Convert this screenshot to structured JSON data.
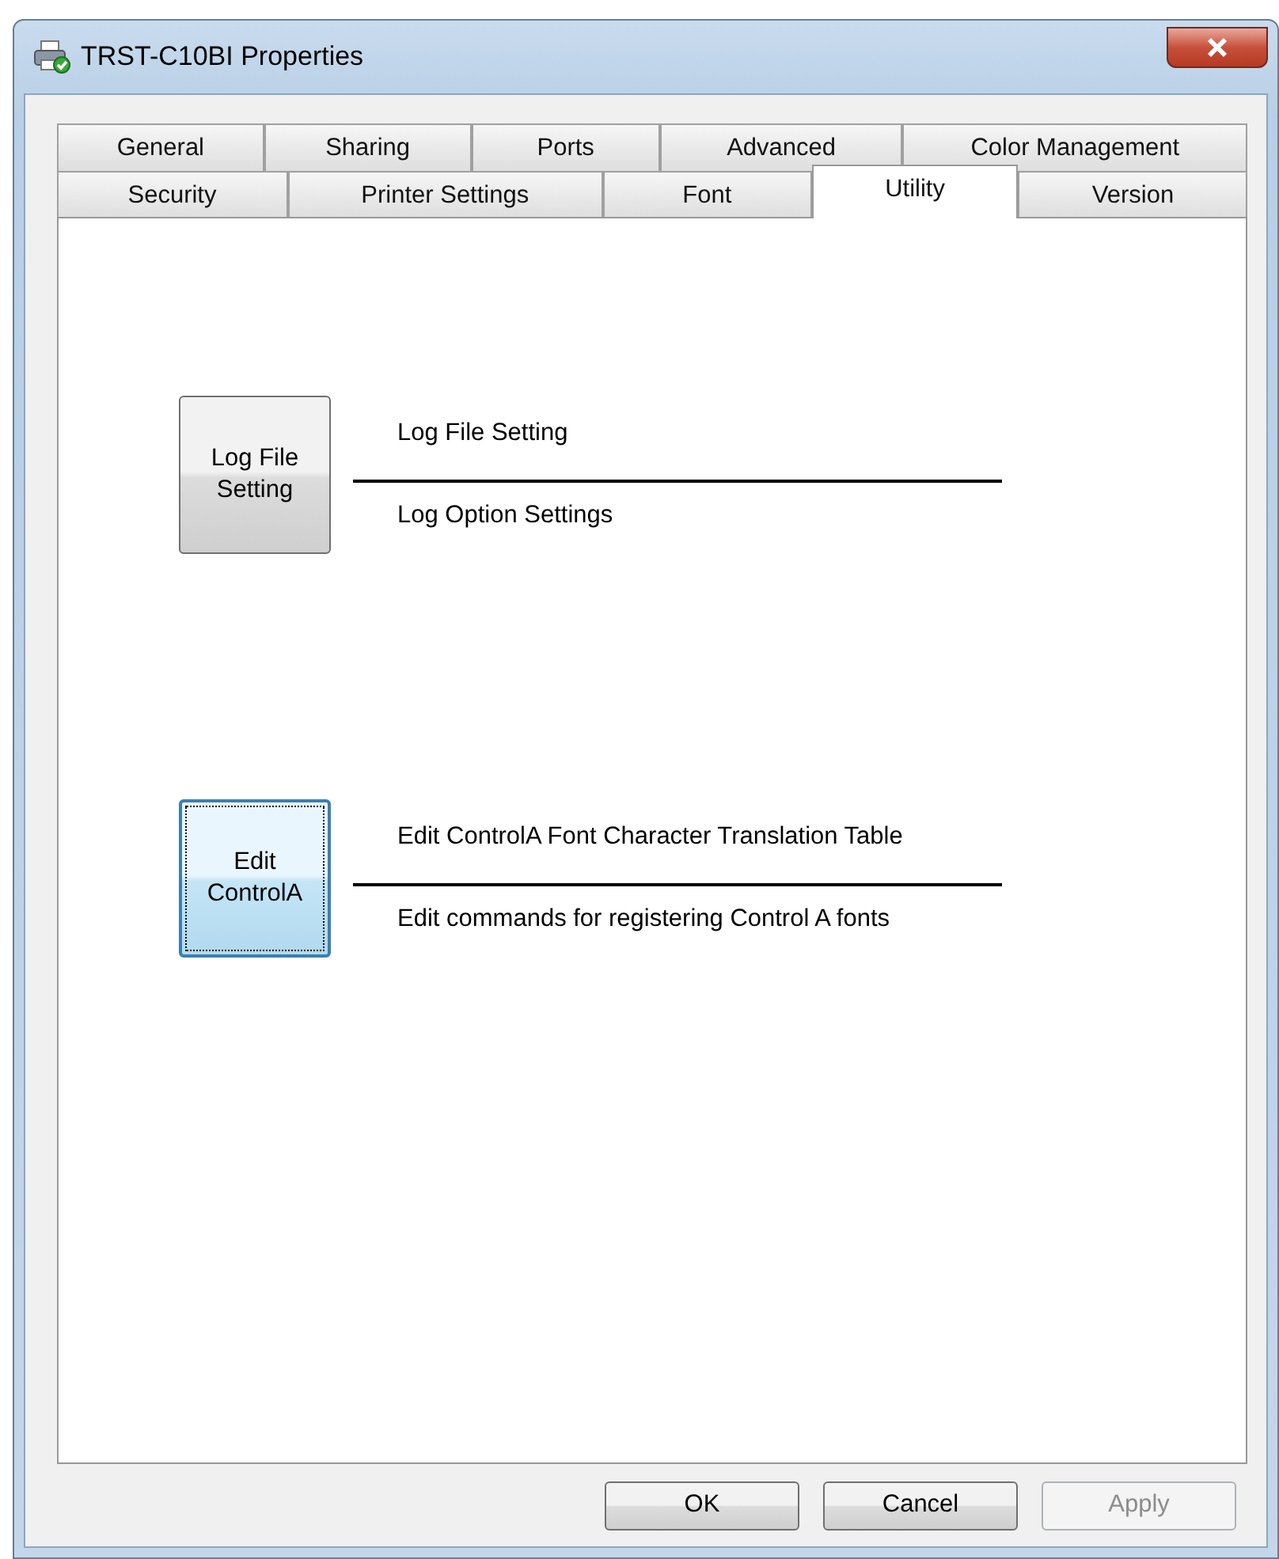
{
  "window": {
    "title": "TRST-C10BI Properties"
  },
  "tab_rows": [
    {
      "tabs": [
        {
          "label": "General",
          "selected": false
        },
        {
          "label": "Sharing",
          "selected": false
        },
        {
          "label": "Ports",
          "selected": false
        },
        {
          "label": "Advanced",
          "selected": false
        },
        {
          "label": "Color Management",
          "selected": false
        }
      ]
    },
    {
      "tabs": [
        {
          "label": "Security",
          "selected": false
        },
        {
          "label": "Printer Settings",
          "selected": false
        },
        {
          "label": "Font",
          "selected": false
        },
        {
          "label": "Utility",
          "selected": true
        },
        {
          "label": "Version",
          "selected": false
        }
      ]
    }
  ],
  "utilities": [
    {
      "button": "Log File Setting",
      "focused": false,
      "title": "Log File Setting",
      "description": "Log Option Settings"
    },
    {
      "button": "Edit ControlA",
      "focused": true,
      "title": "Edit ControlA Font Character Translation Table",
      "description": "Edit commands for registering Control A fonts"
    }
  ],
  "buttons": [
    {
      "label": "OK",
      "disabled": false
    },
    {
      "label": "Cancel",
      "disabled": false
    },
    {
      "label": "Apply",
      "disabled": true
    }
  ]
}
